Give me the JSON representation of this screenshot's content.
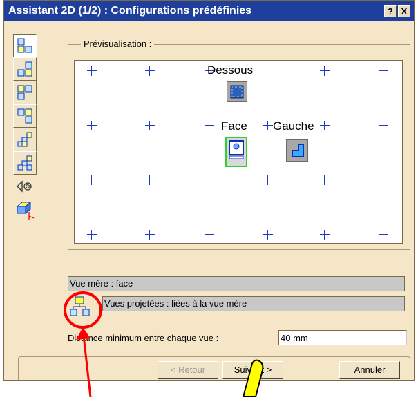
{
  "window": {
    "title": "Assistant 2D (1/2) : Configurations prédéfinies",
    "help_button": "?",
    "close_button": "X"
  },
  "toolbar": {
    "tools": [
      "config-front-top-right",
      "config-front-top-left",
      "config-front-bottom-right",
      "config-front-bottom-left",
      "config-six-views-a",
      "config-six-views-b"
    ],
    "extra_icons": [
      "projection-method-icon",
      "view-axis-icon"
    ]
  },
  "preview": {
    "legend": "Prévisualisation :",
    "labels": {
      "top_view": "Dessous",
      "front_view": "Face",
      "left_view": "Gauche"
    }
  },
  "info": {
    "parent_view": "Vue mère : face",
    "projected_views": "Vues projetées : liées à la vue mère"
  },
  "distance": {
    "label": "Distance minimum entre chaque vue :",
    "value": "40 mm"
  },
  "buttons": {
    "back": "< Retour",
    "next": "Suivant >",
    "cancel": "Annuler"
  },
  "colors": {
    "title_bar": "#1e3f9b",
    "dialog_bg": "#f5e6c8",
    "grid_plus": "#1a3ccc",
    "annotation": "#ff0000",
    "selection_outline": "#2fd12f"
  }
}
